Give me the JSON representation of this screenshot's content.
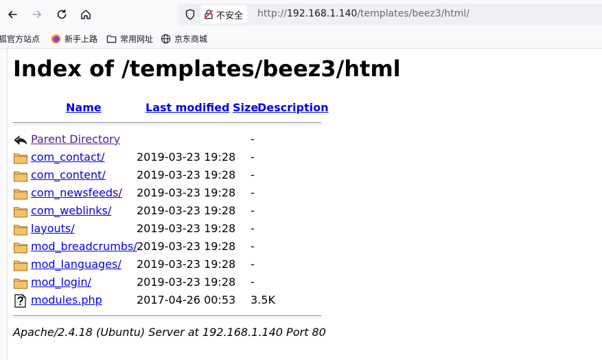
{
  "browser": {
    "security_label": "不安全",
    "url_scheme": "http://",
    "url_host": "192.168.1.140",
    "url_path": "/templates/beez3/html/"
  },
  "bookmarks": [
    {
      "label": "火狐官方站点",
      "icon": "firefox-icon"
    },
    {
      "label": "新手上路",
      "icon": "firefox-icon"
    },
    {
      "label": "常用网址",
      "icon": "folder-icon"
    },
    {
      "label": "京东商城",
      "icon": "globe-icon"
    }
  ],
  "page": {
    "title": "Index of /templates/beez3/html",
    "columns": {
      "name": "Name",
      "modified": "Last modified",
      "size": "Size",
      "description": "Description"
    },
    "rows": [
      {
        "name": "Parent Directory",
        "modified": "",
        "size": "-",
        "icon": "back-icon"
      },
      {
        "name": "com_contact/",
        "modified": "2019-03-23 19:28",
        "size": "-",
        "icon": "folder-icon"
      },
      {
        "name": "com_content/",
        "modified": "2019-03-23 19:28",
        "size": "-",
        "icon": "folder-icon"
      },
      {
        "name": "com_newsfeeds/",
        "modified": "2019-03-23 19:28",
        "size": "-",
        "icon": "folder-icon"
      },
      {
        "name": "com_weblinks/",
        "modified": "2019-03-23 19:28",
        "size": "-",
        "icon": "folder-icon"
      },
      {
        "name": "layouts/",
        "modified": "2019-03-23 19:28",
        "size": "-",
        "icon": "folder-icon"
      },
      {
        "name": "mod_breadcrumbs/",
        "modified": "2019-03-23 19:28",
        "size": "-",
        "icon": "folder-icon"
      },
      {
        "name": "mod_languages/",
        "modified": "2019-03-23 19:28",
        "size": "-",
        "icon": "folder-icon"
      },
      {
        "name": "mod_login/",
        "modified": "2019-03-23 19:28",
        "size": "-",
        "icon": "folder-icon"
      },
      {
        "name": "modules.php",
        "modified": "2017-04-26 00:53",
        "size": "3.5K",
        "icon": "unknown-file-icon"
      }
    ],
    "footer": "Apache/2.4.18 (Ubuntu) Server at 192.168.1.140 Port 80"
  },
  "colors": {
    "link": "#0000ee",
    "visited_link": "#551a8b",
    "folder_fill": "#f5c26b",
    "folder_stroke": "#a06a1c"
  }
}
